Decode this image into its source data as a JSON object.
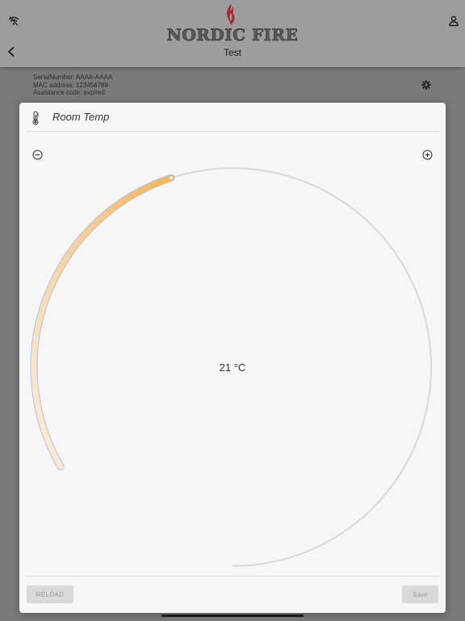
{
  "header": {
    "brand": "NORDIC FIRE",
    "device_name": "Test",
    "icons": [
      "wifi-off-icon",
      "user-icon",
      "back-chevron-icon",
      "flame-logo-icon"
    ]
  },
  "device_info": {
    "serial": "SerialNumber: AAAA-AAAA",
    "mac": "MAC address: 123456789",
    "assistance": "Assistance code: expired",
    "settings_icon": "gear-icon"
  },
  "modal": {
    "title": "Room Temp",
    "title_icon": "thermometer-icon",
    "decrease_icon": "minus-circle-icon",
    "increase_icon": "plus-circle-icon",
    "readout": "21 °C",
    "setpoint_fraction": 0.34,
    "colors": {
      "arc_start": "#fdeede",
      "arc_end": "#f5b653",
      "track": "#d8d8d8",
      "outline": "#aebfe6"
    },
    "reload_label": "RELOAD",
    "save_label": "Save"
  }
}
